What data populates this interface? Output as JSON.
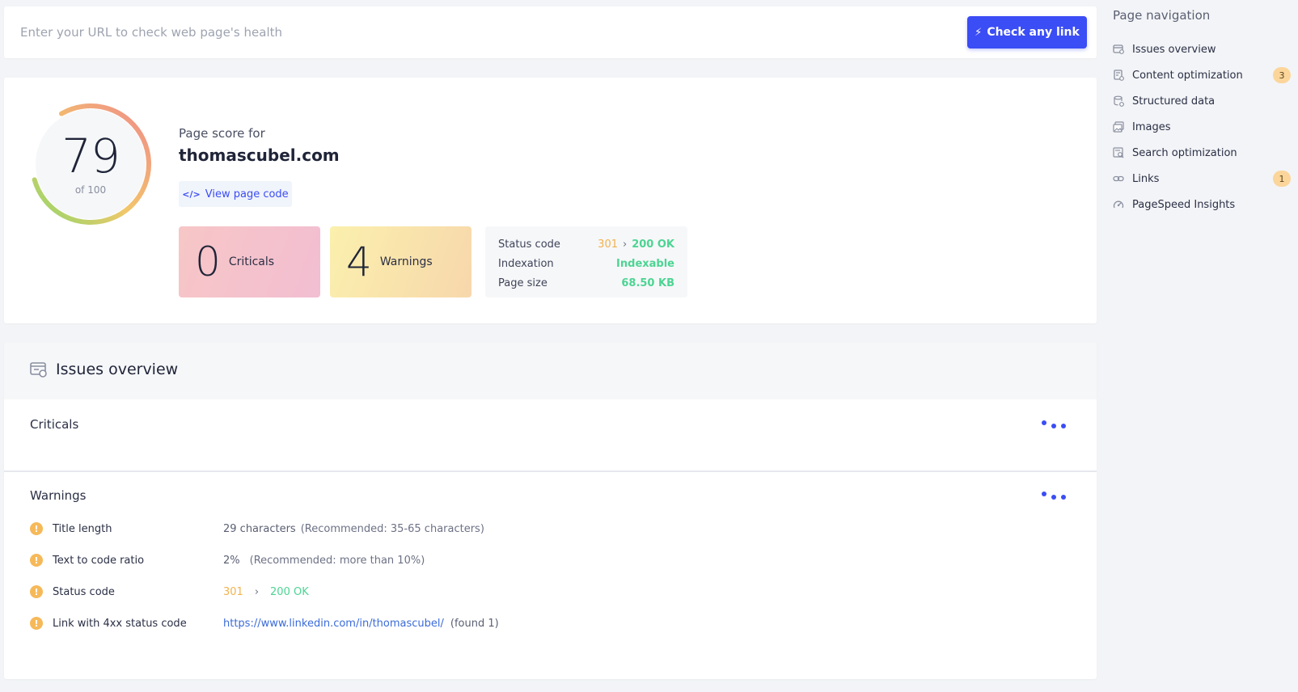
{
  "search": {
    "placeholder": "Enter your URL to check web page's health",
    "value": "",
    "button_label": "Check any link",
    "button_icon": "bolt-icon"
  },
  "score": {
    "value": "79",
    "of_label": "of 100",
    "fraction": 0.79,
    "page_score_label": "Page score for",
    "domain": "thomascubel.com",
    "view_code_label": "View page code"
  },
  "stats": {
    "criticals_count": "0",
    "criticals_label": "Criticals",
    "warnings_count": "4",
    "warnings_label": "Warnings"
  },
  "status": {
    "status_code_label": "Status code",
    "redirect_code": "301",
    "arrow": "›",
    "final_code": "200 OK",
    "indexation_label": "Indexation",
    "indexation_value": "Indexable",
    "page_size_label": "Page size",
    "page_size_value": "68.50 KB"
  },
  "issues": {
    "title": "Issues overview",
    "criticals_title": "Criticals",
    "warnings_title": "Warnings",
    "warnings": [
      {
        "name": "Title length",
        "value": "29 characters",
        "recommendation": "(Recommended: 35-65 characters)"
      },
      {
        "name": "Text to code ratio",
        "value": "2%",
        "recommendation": "(Recommended: more than 10%)"
      },
      {
        "name": "Status code",
        "from": "301",
        "arrow": "›",
        "to": "200 OK"
      },
      {
        "name": "Link with 4xx status code",
        "link": "https://www.linkedin.com/in/thomascubel/",
        "found": "(found 1)"
      }
    ]
  },
  "nav": {
    "title": "Page navigation",
    "items": [
      {
        "label": "Issues overview",
        "icon": "issues-icon",
        "badge": ""
      },
      {
        "label": "Content optimization",
        "icon": "content-icon",
        "badge": "3"
      },
      {
        "label": "Structured data",
        "icon": "structured-data-icon",
        "badge": ""
      },
      {
        "label": "Images",
        "icon": "images-icon",
        "badge": ""
      },
      {
        "label": "Search optimization",
        "icon": "search-optimization-icon",
        "badge": ""
      },
      {
        "label": "Links",
        "icon": "link-icon",
        "badge": "1"
      },
      {
        "label": "PageSpeed Insights",
        "icon": "speedometer-icon",
        "badge": ""
      }
    ]
  },
  "colors": {
    "accent": "#3b4df5",
    "ok_green": "#4dd493",
    "warn_orange": "#f2b24f"
  }
}
